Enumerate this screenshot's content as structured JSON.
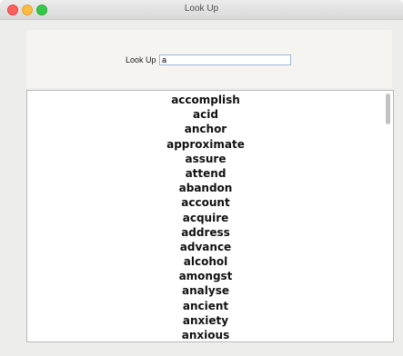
{
  "window": {
    "title": "Look Up"
  },
  "lookup": {
    "label": "Look Up",
    "value": "a"
  },
  "words": [
    "accomplish",
    "acid",
    "anchor",
    "approximate",
    "assure",
    "attend",
    "abandon",
    "account",
    "acquire",
    "address",
    "advance",
    "alcohol",
    "amongst",
    "analyse",
    "ancient",
    "anxiety",
    "anxious"
  ],
  "colors": {
    "close": "#fc605c",
    "minimize": "#fdbc40",
    "maximize": "#34c84a",
    "input_border": "#9eb7d6"
  }
}
